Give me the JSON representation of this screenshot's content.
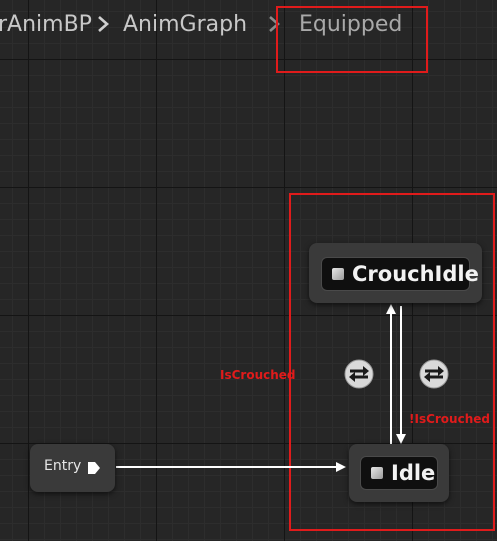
{
  "breadcrumb": {
    "items": [
      "rAnimBP",
      "AnimGraph",
      "Equipped"
    ]
  },
  "state_machine": {
    "entry": {
      "label": "Entry"
    },
    "states": [
      {
        "label": "CrouchIdle"
      },
      {
        "label": "Idle"
      }
    ],
    "transitions": [
      {
        "rule_label": "IsCrouched",
        "from": "Idle",
        "to": "CrouchIdle"
      },
      {
        "rule_label": "!IsCrouched",
        "from": "CrouchIdle",
        "to": "Idle"
      }
    ]
  },
  "colors": {
    "background": "#262626",
    "highlight": "#e01b1b",
    "node": "#3a3a3a",
    "wire": "#ffffff"
  },
  "icons": {
    "breadcrumb_separator": "chevron-right-icon",
    "entry_pin": "exec-pin-icon",
    "state": "state-square-icon",
    "transition": "transition-rule-icon"
  }
}
